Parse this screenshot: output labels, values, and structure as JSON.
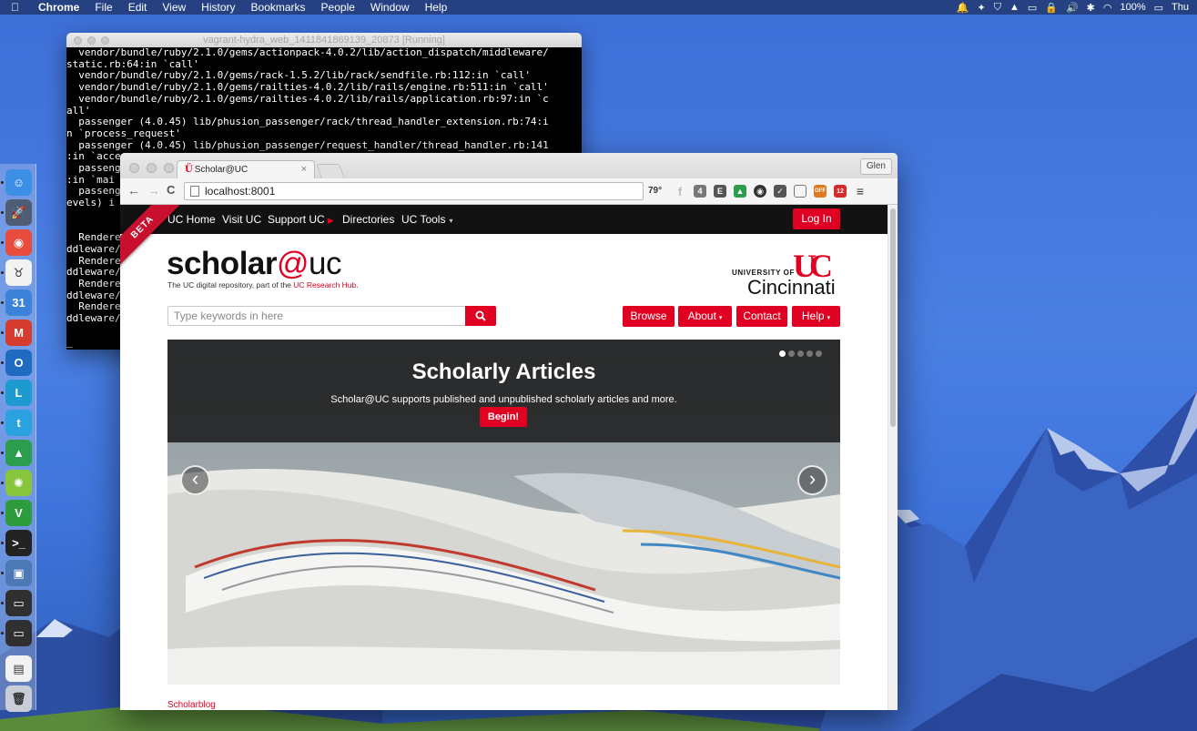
{
  "menubar": {
    "app": "Chrome",
    "items": [
      "File",
      "Edit",
      "View",
      "History",
      "Bookmarks",
      "People",
      "Window",
      "Help"
    ],
    "battery": "100%",
    "clock": "Thu"
  },
  "dock": {
    "apps": [
      {
        "name": "finder-icon",
        "glyph": "☺",
        "color": "#3d8fe6"
      },
      {
        "name": "launchpad-icon",
        "glyph": "🚀",
        "color": "#4e5d74"
      },
      {
        "name": "chrome-icon",
        "glyph": "◉",
        "color": "#e74c3c"
      },
      {
        "name": "cow-app-icon",
        "glyph": "♉",
        "color": "#f2f2f2"
      },
      {
        "name": "calendar-icon",
        "glyph": "31",
        "color": "#3b82d8"
      },
      {
        "name": "gmail-icon",
        "glyph": "M",
        "color": "#d63b30"
      },
      {
        "name": "outlook-icon",
        "glyph": "O",
        "color": "#1f6bc1"
      },
      {
        "name": "lync-icon",
        "glyph": "L",
        "color": "#1d9bd1"
      },
      {
        "name": "twitter-icon",
        "glyph": "t",
        "color": "#2aa2e0"
      },
      {
        "name": "drive-icon",
        "glyph": "▲",
        "color": "#2c9d4c"
      },
      {
        "name": "lime-icon",
        "glyph": "✺",
        "color": "#86c53c"
      },
      {
        "name": "vim-icon",
        "glyph": "V",
        "color": "#2e9b3c"
      },
      {
        "name": "terminal-icon",
        "glyph": ">_",
        "color": "#222222"
      },
      {
        "name": "virtualbox-icon",
        "glyph": "▣",
        "color": "#4a79b5"
      },
      {
        "name": "vm-window-icon",
        "glyph": "▭",
        "color": "#303030"
      },
      {
        "name": "vm-window-2-icon",
        "glyph": "▭",
        "color": "#303030"
      },
      {
        "name": "documents-icon",
        "glyph": "▤",
        "color": "#f2f2f2"
      },
      {
        "name": "trash-icon",
        "glyph": "🗑",
        "color": "#c9ced6"
      }
    ]
  },
  "terminal": {
    "title": "vagrant-hydra_web_1411841869139_20873 [Running]",
    "lines": [
      "  vendor/bundle/ruby/2.1.0/gems/actionpack-4.0.2/lib/action_dispatch/middleware/",
      "static.rb:64:in `call'",
      "  vendor/bundle/ruby/2.1.0/gems/rack-1.5.2/lib/rack/sendfile.rb:112:in `call'",
      "  vendor/bundle/ruby/2.1.0/gems/railties-4.0.2/lib/rails/engine.rb:511:in `call'",
      "  vendor/bundle/ruby/2.1.0/gems/railties-4.0.2/lib/rails/application.rb:97:in `c",
      "all'",
      "  passenger (4.0.45) lib/phusion_passenger/rack/thread_handler_extension.rb:74:i",
      "n `process_request'",
      "  passenger (4.0.45) lib/phusion_passenger/request_handler/thread_handler.rb:141",
      ":in `acce",
      "  passeng",
      ":in `mai",
      "  passeng",
      "evels) i",
      "",
      "",
      "  Rendere",
      "ddleware/",
      "  Rendere",
      "ddleware/",
      "  Rendere",
      "ddleware/",
      "  Rendere",
      "ddleware/",
      "",
      "_"
    ]
  },
  "browser": {
    "tab_title": "Scholar@UC",
    "tab_close": "×",
    "profile": "Glen",
    "url": "localhost:8001",
    "weather": "79°",
    "ext_badges": {
      "mail": "4",
      "todo": "12",
      "ghost": "OFF"
    }
  },
  "site": {
    "beta": "BETA",
    "nav": {
      "uc_home": "UC Home",
      "visit_uc": "Visit UC",
      "support_uc": "Support UC",
      "support_arrow": "▶",
      "directories": "Directories",
      "uc_tools": "UC Tools",
      "caret": "▾"
    },
    "login": "Log In",
    "logo": {
      "scholar": "scholar",
      "at": "@",
      "uc": "uc"
    },
    "tagline_pre": "The UC digital repository, part of the ",
    "tagline_link": "UC Research Hub",
    "tagline_post": ".",
    "university": {
      "of": "UNIVERSITY OF",
      "mark": "UC",
      "name": "Cincinnati"
    },
    "search_placeholder": "Type keywords in here",
    "buttons": {
      "browse": "Browse",
      "about": "About",
      "contact": "Contact",
      "help": "Help",
      "caret": "▾"
    },
    "carousel": {
      "title": "Scholarly Articles",
      "text": "Scholar@UC supports published and unpublished scholarly articles and more.",
      "cta": "Begin!",
      "prev": "‹",
      "next": "›",
      "slide_count": 5,
      "active_slide": 1
    },
    "footer_link": "Scholarblog"
  }
}
